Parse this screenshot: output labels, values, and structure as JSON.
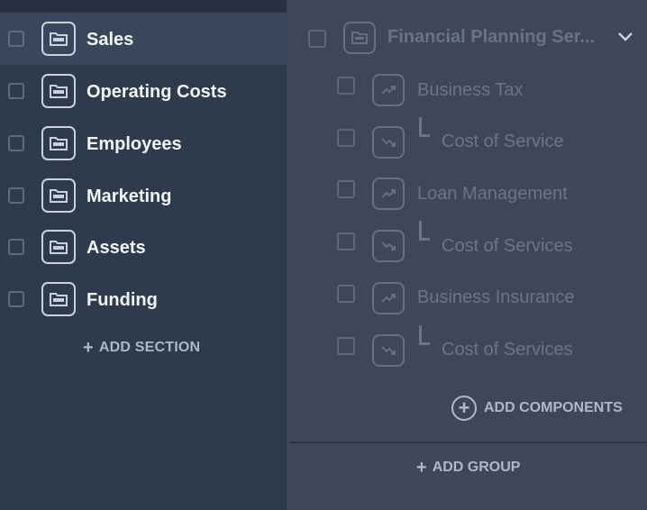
{
  "sections": {
    "items": [
      {
        "label": "Sales",
        "icon": "folder-icon",
        "active": true
      },
      {
        "label": "Operating Costs",
        "icon": "folder-icon",
        "active": false
      },
      {
        "label": "Employees",
        "icon": "folder-icon",
        "active": false
      },
      {
        "label": "Marketing",
        "icon": "folder-icon",
        "active": false
      },
      {
        "label": "Assets",
        "icon": "folder-icon",
        "active": false
      },
      {
        "label": "Funding",
        "icon": "folder-icon",
        "active": false
      }
    ],
    "add_label": "ADD SECTION"
  },
  "group": {
    "title": "Financial Planning Ser...",
    "icon": "folder-icon",
    "expand_icon": "chevron-down-icon",
    "components": [
      {
        "label": "Business Tax",
        "icon": "trend-up-icon",
        "child": false
      },
      {
        "label": "Cost of Service",
        "icon": "trend-down-icon",
        "child": true
      },
      {
        "label": "Loan Management",
        "icon": "trend-up-icon",
        "child": false
      },
      {
        "label": "Cost of Services",
        "icon": "trend-down-icon",
        "child": true
      },
      {
        "label": "Business Insurance",
        "icon": "trend-up-icon",
        "child": false
      },
      {
        "label": "Cost of Services",
        "icon": "trend-down-icon",
        "child": true
      }
    ],
    "add_components_label": "ADD COMPONENTS",
    "add_group_label": "ADD GROUP"
  },
  "colors": {
    "left_bg": "#2f3a4d",
    "right_bg": "#3d4759",
    "active_row": "#3a465b",
    "muted_text": "#6b7587",
    "accent_text": "#aeb8c6"
  }
}
